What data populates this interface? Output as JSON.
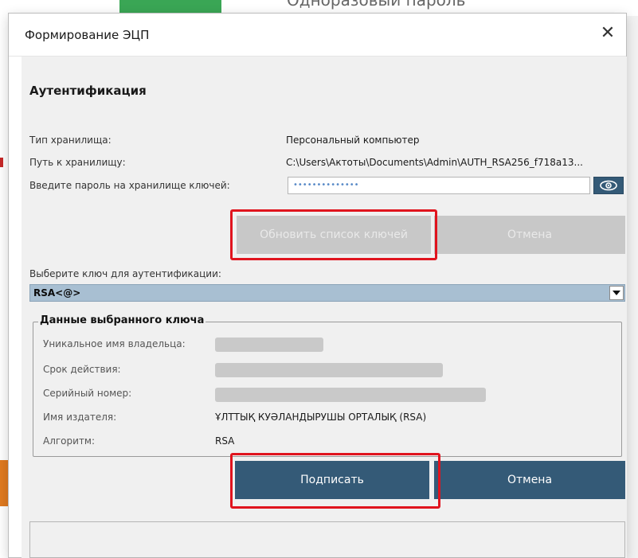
{
  "background": {
    "tab_text": "Одноразовый пароль"
  },
  "dialog": {
    "title": "Формирование ЭЦП",
    "close_glyph": "✕"
  },
  "auth": {
    "section_title": "Аутентификация",
    "storage_type_label": "Тип хранилища:",
    "storage_type_value": "Персональный компьютер",
    "storage_path_label": "Путь к хранилищу:",
    "storage_path_value": "C:\\Users\\Актоты\\Documents\\Admin\\AUTH_RSA256_f718a13...",
    "password_label": "Введите пароль на хранилище ключей:",
    "password_value": "••••••••••••••",
    "show_password_icon": "eye-icon",
    "refresh_button": "Обновить список ключей",
    "cancel_top_button": "Отмена",
    "choose_key_label": "Выберите ключ для аутентификации:",
    "selected_key": "RSA<@>"
  },
  "key_info": {
    "group_title": "Данные выбранного ключа",
    "owner_label": "Уникальное имя владельца:",
    "validity_label": "Срок действия:",
    "serial_label": "Серийный номер:",
    "issuer_label": "Имя издателя:",
    "issuer_value": "ҰЛТТЫҚ КУӘЛАНДЫРУШЫ ОРТАЛЫҚ (RSA)",
    "algorithm_label": "Алгоритм:",
    "algorithm_value": "RSA"
  },
  "actions": {
    "sign_button": "Подписать",
    "cancel_button": "Отмена"
  },
  "colors": {
    "primary": "#345a77",
    "highlight": "#e0141e",
    "disabled": "#c8c8c8"
  }
}
